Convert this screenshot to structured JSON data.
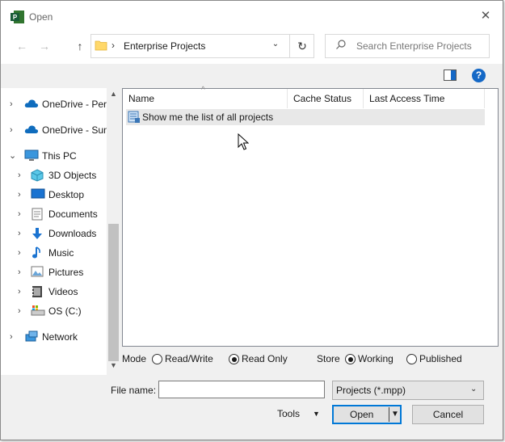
{
  "window": {
    "title": "Open",
    "app_icon": "ms-project-icon",
    "close": "✕"
  },
  "nav": {
    "back": "←",
    "forward": "→",
    "up": "↑"
  },
  "address": {
    "separator": "›",
    "path": "Enterprise Projects",
    "dropdown": "⌄",
    "refresh": "↻"
  },
  "search": {
    "placeholder": "Search Enterprise Projects",
    "value": ""
  },
  "toolbar": {
    "help": "?"
  },
  "sidebar": {
    "items": [
      {
        "label": "OneDrive - Pers",
        "icon": "onedrive-icon",
        "chevron": "›"
      },
      {
        "label": "OneDrive - Sun",
        "icon": "onedrive-icon",
        "chevron": "›"
      },
      {
        "label": "This PC",
        "icon": "computer-icon",
        "chevron": "⌄"
      },
      {
        "label": "3D Objects",
        "icon": "3d-objects-icon",
        "chevron": "›"
      },
      {
        "label": "Desktop",
        "icon": "desktop-icon",
        "chevron": "›"
      },
      {
        "label": "Documents",
        "icon": "documents-icon",
        "chevron": "›"
      },
      {
        "label": "Downloads",
        "icon": "downloads-icon",
        "chevron": "›"
      },
      {
        "label": "Music",
        "icon": "music-icon",
        "chevron": "›"
      },
      {
        "label": "Pictures",
        "icon": "pictures-icon",
        "chevron": "›"
      },
      {
        "label": "Videos",
        "icon": "videos-icon",
        "chevron": "›"
      },
      {
        "label": "OS (C:)",
        "icon": "drive-icon",
        "chevron": "›"
      },
      {
        "label": "Network",
        "icon": "network-icon",
        "chevron": "›"
      }
    ]
  },
  "file_list": {
    "columns": [
      "Name",
      "Cache Status",
      "Last Access Time"
    ],
    "sort_indicator": "^",
    "rows": [
      {
        "name": "Show me the list of all projects",
        "cache_status": "",
        "last_access": ""
      }
    ]
  },
  "mode": {
    "mode_label": "Mode",
    "read_write": "Read/Write",
    "read_only": "Read Only",
    "selected_mode": "Read Only",
    "store_label": "Store",
    "working": "Working",
    "published": "Published",
    "selected_store": "Working"
  },
  "file_name": {
    "label": "File name:",
    "value": ""
  },
  "file_type": {
    "selected": "Projects (*.mpp)",
    "arrow": "⌄"
  },
  "actions": {
    "tools": "Tools",
    "tools_arrow": "▼",
    "open": "Open",
    "open_arrow": "▼",
    "cancel": "Cancel"
  },
  "colors": {
    "accent": "#0078d7",
    "help": "#1468c6",
    "selection": "#e8e8e8"
  }
}
